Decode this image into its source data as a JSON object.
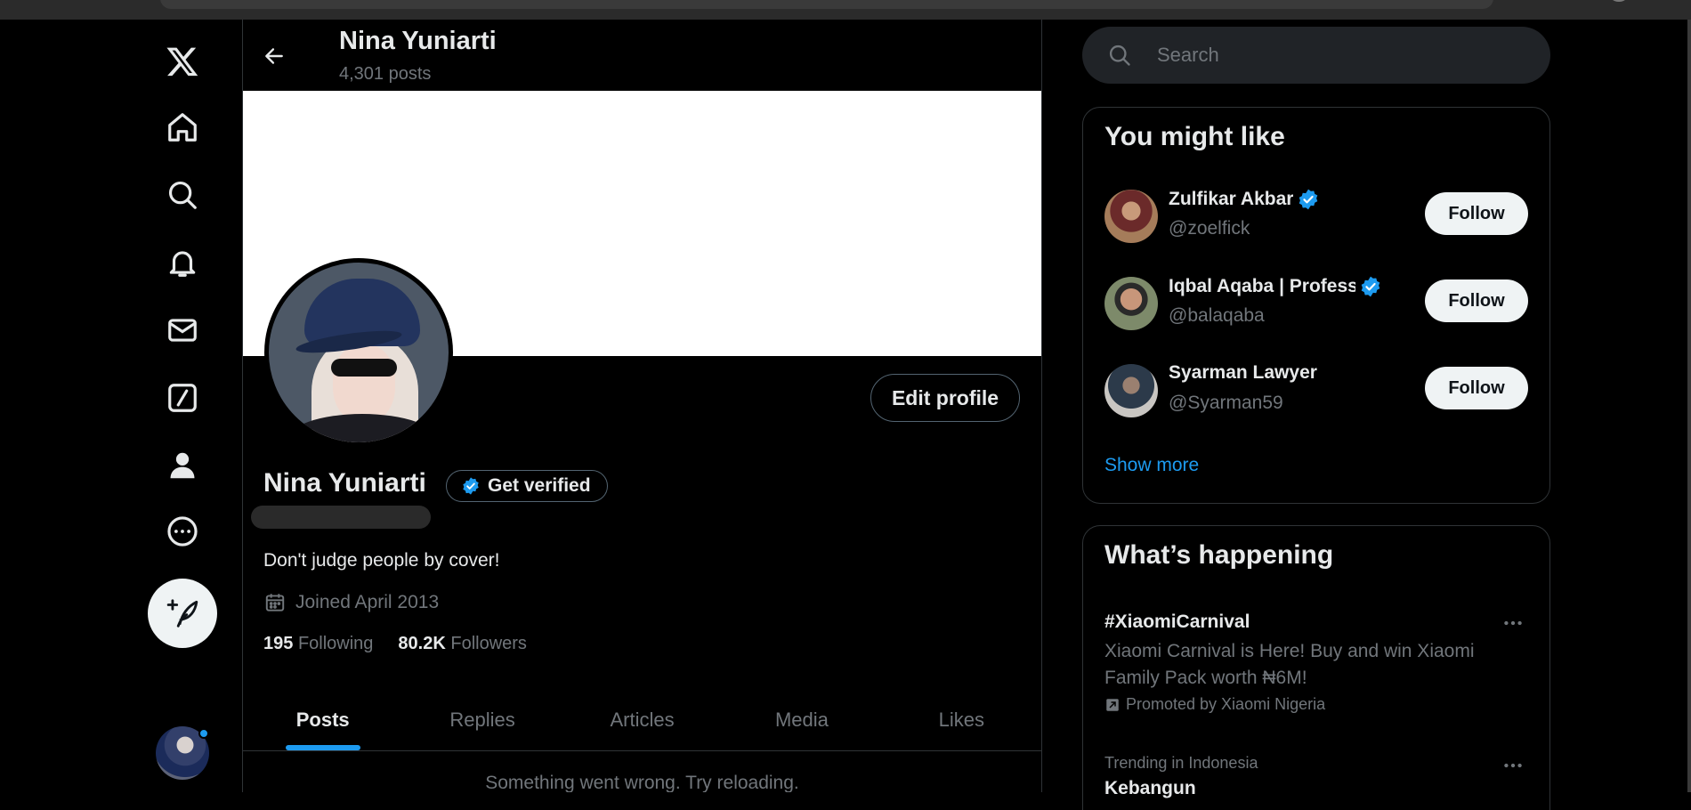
{
  "header": {
    "name": "Nina Yuniarti",
    "post_count": "4,301 posts"
  },
  "profile": {
    "name": "Nina Yuniarti",
    "get_verified_label": "Get verified",
    "edit_profile_label": "Edit profile",
    "bio": "Don't judge people by cover!",
    "joined": "Joined April 2013",
    "following_count": "195",
    "following_label": "Following",
    "followers_count": "80.2K",
    "followers_label": "Followers"
  },
  "tabs": [
    {
      "label": "Posts",
      "active": true
    },
    {
      "label": "Replies",
      "active": false
    },
    {
      "label": "Articles",
      "active": false
    },
    {
      "label": "Media",
      "active": false
    },
    {
      "label": "Likes",
      "active": false
    }
  ],
  "error_text": "Something went wrong. Try reloading.",
  "nav": {
    "icons": [
      "x-logo-icon",
      "home-icon",
      "explore-icon",
      "notifications-icon",
      "messages-icon",
      "grok-icon",
      "profile-icon",
      "more-icon"
    ],
    "post_icon": "feather-plus-icon"
  },
  "search": {
    "placeholder": "Search"
  },
  "you_might_like": {
    "title": "You might like",
    "suggestions": [
      {
        "name": "Zulfikar Akbar",
        "handle": "@zoelfick",
        "verified": true,
        "follow_label": "Follow"
      },
      {
        "name": "Iqbal Aqaba | Professi",
        "handle": "@balaqaba",
        "verified": true,
        "follow_label": "Follow"
      },
      {
        "name": "Syarman Lawyer",
        "handle": "@Syarman59",
        "verified": false,
        "follow_label": "Follow"
      }
    ],
    "show_more": "Show more"
  },
  "whats_happening": {
    "title": "What’s happening",
    "trends": [
      {
        "title": "#XiaomiCarnival",
        "description": "Xiaomi Carnival is Here! Buy and win Xiaomi Family Pack worth ₦6M!",
        "promoted": "Promoted by Xiaomi Nigeria"
      },
      {
        "meta": "Trending in Indonesia",
        "title": "Kebangun"
      }
    ]
  },
  "colors": {
    "background": "#000000",
    "accent": "#1d9bf0",
    "text": "#e7e9ea",
    "muted": "#71767b",
    "border": "#2f3336"
  }
}
